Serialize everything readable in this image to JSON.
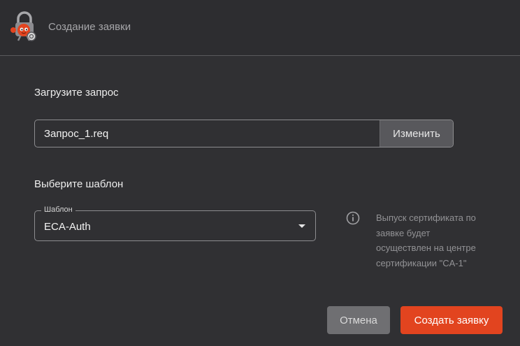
{
  "header": {
    "title": "Создание заявки"
  },
  "upload": {
    "section_label": "Загрузите запрос",
    "file_name": "Запрос_1.req",
    "change_label": "Изменить"
  },
  "template": {
    "section_label": "Выберите шаблон",
    "field_label": "Шаблон",
    "selected_value": "ECA-Auth"
  },
  "info": {
    "lines": [
      "Выпуск сертификата по",
      "заявке будет",
      "осуществлен на центре",
      "сертификации \"CA-1\""
    ]
  },
  "actions": {
    "cancel_label": "Отмена",
    "create_label": "Создать заявку"
  },
  "colors": {
    "background": "#303033",
    "accent": "#e2441f",
    "secondary_button": "#6f6f72"
  },
  "icons": {
    "logo": "padlock-character-logo",
    "info": "info-circle-icon",
    "dropdown": "triangle-down-icon"
  }
}
